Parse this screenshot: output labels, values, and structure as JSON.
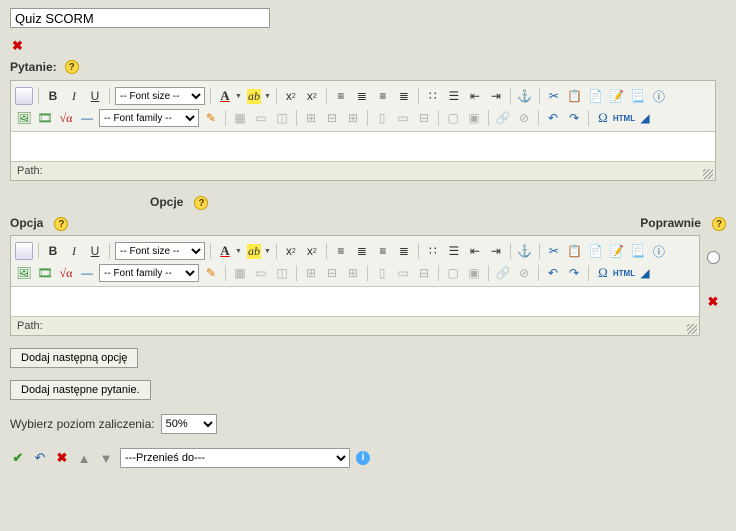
{
  "title_field": {
    "value": "Quiz SCORM"
  },
  "labels": {
    "pytanie": "Pytanie:",
    "opcje": "Opcje",
    "opcja": "Opcja",
    "poprawnie": "Poprawnie",
    "path": "Path:"
  },
  "font_size_select": "-- Font size --",
  "font_family_select": "-- Font family --",
  "buttons": {
    "add_option": "Dodaj następną opcję",
    "add_question": "Dodaj następne pytanie."
  },
  "level": {
    "label": "Wybierz poziom zaliczenia:",
    "value": "50%"
  },
  "move_to": {
    "value": "---Przenieś do---"
  },
  "chart_data": null
}
